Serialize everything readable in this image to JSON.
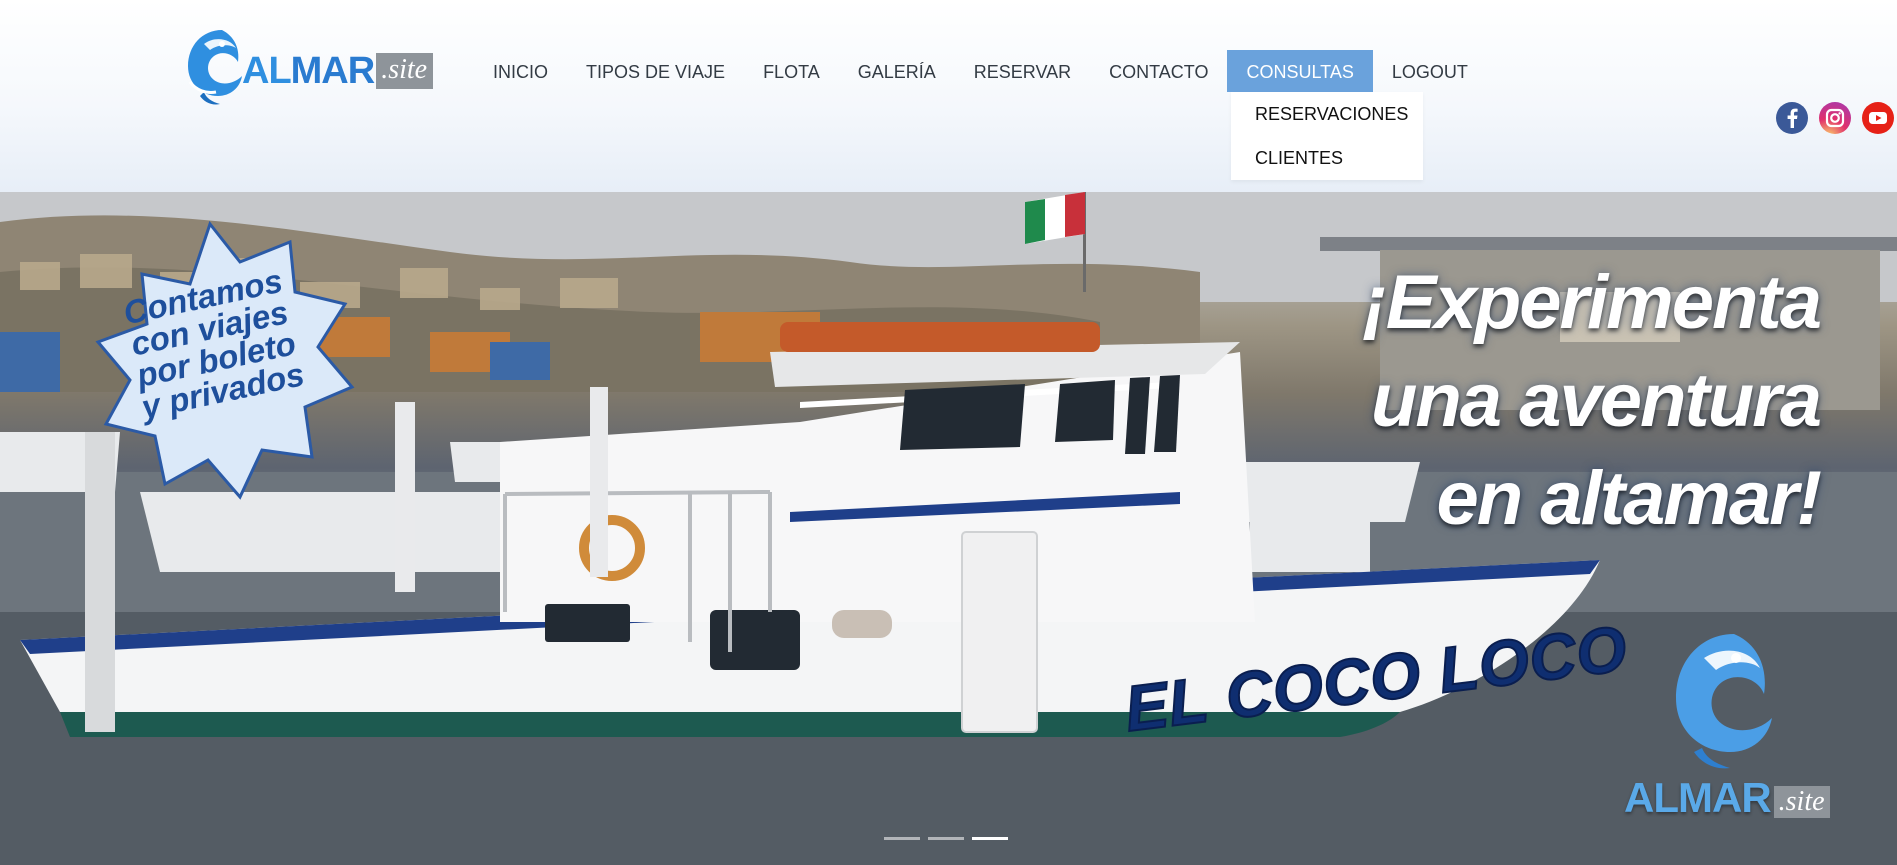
{
  "brand": {
    "name_part1": "AL",
    "name_part2": "MAR",
    "suffix": ".site",
    "icon": "fish-logo-icon"
  },
  "nav": {
    "items": [
      {
        "label": "INICIO"
      },
      {
        "label": "TIPOS DE VIAJE"
      },
      {
        "label": "FLOTA"
      },
      {
        "label": "GALERÍA"
      },
      {
        "label": "RESERVAR"
      },
      {
        "label": "CONTACTO"
      },
      {
        "label": "CONSULTAS",
        "active": true
      },
      {
        "label": "LOGOUT"
      }
    ],
    "dropdown": [
      {
        "label": "RESERVACIONES"
      },
      {
        "label": "CLIENTES"
      }
    ],
    "active_color": "#6aa2dc"
  },
  "social": [
    {
      "icon": "facebook-icon",
      "color": "#3b5998"
    },
    {
      "icon": "instagram-icon",
      "color": "#c13584"
    },
    {
      "icon": "youtube-icon",
      "color": "#e62117"
    }
  ],
  "hero": {
    "badge_lines": [
      "Contamos",
      "con viajes",
      "por boleto",
      "y privados"
    ],
    "headline_lines": [
      "¡Experimenta",
      "una aventura",
      "en altamar!"
    ],
    "boat_name": "EL COCO LOCO",
    "watermark_name_part1": "AL",
    "watermark_name_part2": "MAR",
    "watermark_suffix": ".site",
    "slides": 3,
    "active_slide": 3
  }
}
